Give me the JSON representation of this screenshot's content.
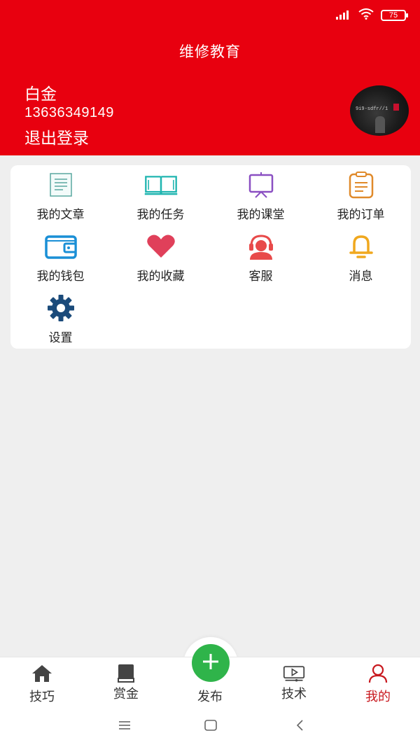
{
  "status_bar": {
    "battery": "75"
  },
  "header": {
    "title": "维修教育",
    "user_name": "白金",
    "phone": "13636349149",
    "logout_label": "退出登录",
    "avatar_text": "9i9-sdfr//1"
  },
  "menu": {
    "items": [
      {
        "label": "我的文章",
        "icon": "article-icon",
        "color": "#5aa8a0"
      },
      {
        "label": "我的任务",
        "icon": "open-book-icon",
        "color": "#1fb5b0"
      },
      {
        "label": "我的课堂",
        "icon": "presentation-board-icon",
        "color": "#8a4fc2"
      },
      {
        "label": "我的订单",
        "icon": "clipboard-icon",
        "color": "#e08a2a"
      },
      {
        "label": "我的钱包",
        "icon": "wallet-icon",
        "color": "#1a8fd6"
      },
      {
        "label": "我的收藏",
        "icon": "heart-icon",
        "color": "#e0405a"
      },
      {
        "label": "客服",
        "icon": "headset-support-icon",
        "color": "#e84a4a"
      },
      {
        "label": "消息",
        "icon": "bell-icon",
        "color": "#f0a81e"
      },
      {
        "label": "设置",
        "icon": "gear-icon",
        "color": "#1a4a7a"
      }
    ]
  },
  "tabbar": {
    "tabs": [
      {
        "label": "技巧",
        "icon": "home-icon"
      },
      {
        "label": "赏金",
        "icon": "book-icon"
      },
      {
        "label": "发布",
        "icon": "plus-icon"
      },
      {
        "label": "技术",
        "icon": "video-play-icon"
      },
      {
        "label": "我的",
        "icon": "user-icon",
        "active": true
      }
    ]
  },
  "colors": {
    "brand_red": "#e8000f",
    "fab_green": "#2fb44a",
    "active_tab": "#c8181e"
  }
}
